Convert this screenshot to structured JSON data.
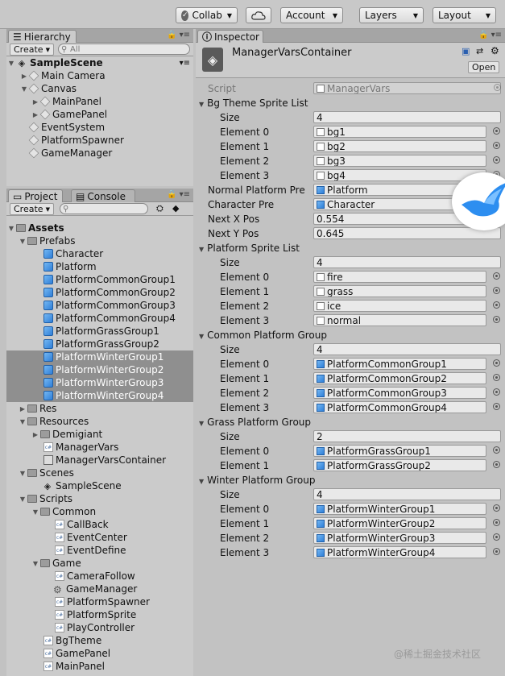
{
  "toolbar": {
    "collab": "Collab",
    "account": "Account",
    "layers": "Layers",
    "layout": "Layout"
  },
  "hierarchy": {
    "tab": "Hierarchy",
    "create": "Create",
    "search_placeholder": "All",
    "scene": "SampleScene",
    "items": [
      "Main Camera",
      "Canvas",
      "MainPanel",
      "GamePanel",
      "EventSystem",
      "PlatformSpawner",
      "GameManager"
    ]
  },
  "project": {
    "tab_project": "Project",
    "tab_console": "Console",
    "create": "Create",
    "assets": "Assets",
    "prefabs": "Prefabs",
    "prefab_items": [
      "Character",
      "Platform",
      "PlatformCommonGroup1",
      "PlatformCommonGroup2",
      "PlatformCommonGroup3",
      "PlatformCommonGroup4",
      "PlatformGrassGroup1",
      "PlatformGrassGroup2",
      "PlatformWinterGroup1",
      "PlatformWinterGroup2",
      "PlatformWinterGroup3",
      "PlatformWinterGroup4"
    ],
    "res": "Res",
    "resources": "Resources",
    "demigiant": "Demigiant",
    "managervars": "ManagerVars",
    "managervarscontainer": "ManagerVarsContainer",
    "scenes": "Scenes",
    "samplescene": "SampleScene",
    "scripts": "Scripts",
    "common": "Common",
    "common_items": [
      "CallBack",
      "EventCenter",
      "EventDefine"
    ],
    "game": "Game",
    "game_items": [
      "CameraFollow",
      "GameManager",
      "PlatformSpawner",
      "PlatformSprite",
      "PlayController"
    ],
    "script_items": [
      "BgTheme",
      "GamePanel",
      "MainPanel"
    ]
  },
  "inspector": {
    "tab": "Inspector",
    "title": "ManagerVarsContainer",
    "open": "Open",
    "script_label": "Script",
    "script_value": "ManagerVars",
    "size": "Size",
    "bg_list": "Bg Theme Sprite List",
    "bg_size": "4",
    "bg_elements": [
      {
        "label": "Element 0",
        "value": "bg1"
      },
      {
        "label": "Element 1",
        "value": "bg2"
      },
      {
        "label": "Element 2",
        "value": "bg3"
      },
      {
        "label": "Element 3",
        "value": "bg4"
      }
    ],
    "normal_platform_label": "Normal Platform Pre",
    "normal_platform_value": "Platform",
    "character_label": "Character Pre",
    "character_value": "Character",
    "next_x_label": "Next X Pos",
    "next_x_value": "0.554",
    "next_y_label": "Next Y Pos",
    "next_y_value": "0.645",
    "platform_sprite_list": "Platform Sprite List",
    "ps_size": "4",
    "ps_elements": [
      {
        "label": "Element 0",
        "value": "fire"
      },
      {
        "label": "Element 1",
        "value": "grass"
      },
      {
        "label": "Element 2",
        "value": "ice"
      },
      {
        "label": "Element 3",
        "value": "normal"
      }
    ],
    "common_group": "Common Platform Group",
    "cg_size": "4",
    "cg_elements": [
      {
        "label": "Element 0",
        "value": "PlatformCommonGroup1"
      },
      {
        "label": "Element 1",
        "value": "PlatformCommonGroup2"
      },
      {
        "label": "Element 2",
        "value": "PlatformCommonGroup3"
      },
      {
        "label": "Element 3",
        "value": "PlatformCommonGroup4"
      }
    ],
    "grass_group": "Grass Platform Group",
    "gg_size": "2",
    "gg_elements": [
      {
        "label": "Element 0",
        "value": "PlatformGrassGroup1"
      },
      {
        "label": "Element 1",
        "value": "PlatformGrassGroup2"
      }
    ],
    "winter_group": "Winter Platform Group",
    "wg_size": "4",
    "wg_elements": [
      {
        "label": "Element 0",
        "value": "PlatformWinterGroup1"
      },
      {
        "label": "Element 1",
        "value": "PlatformWinterGroup2"
      },
      {
        "label": "Element 2",
        "value": "PlatformWinterGroup3"
      },
      {
        "label": "Element 3",
        "value": "PlatformWinterGroup4"
      }
    ]
  },
  "watermark": "@稀土掘金技术社区"
}
